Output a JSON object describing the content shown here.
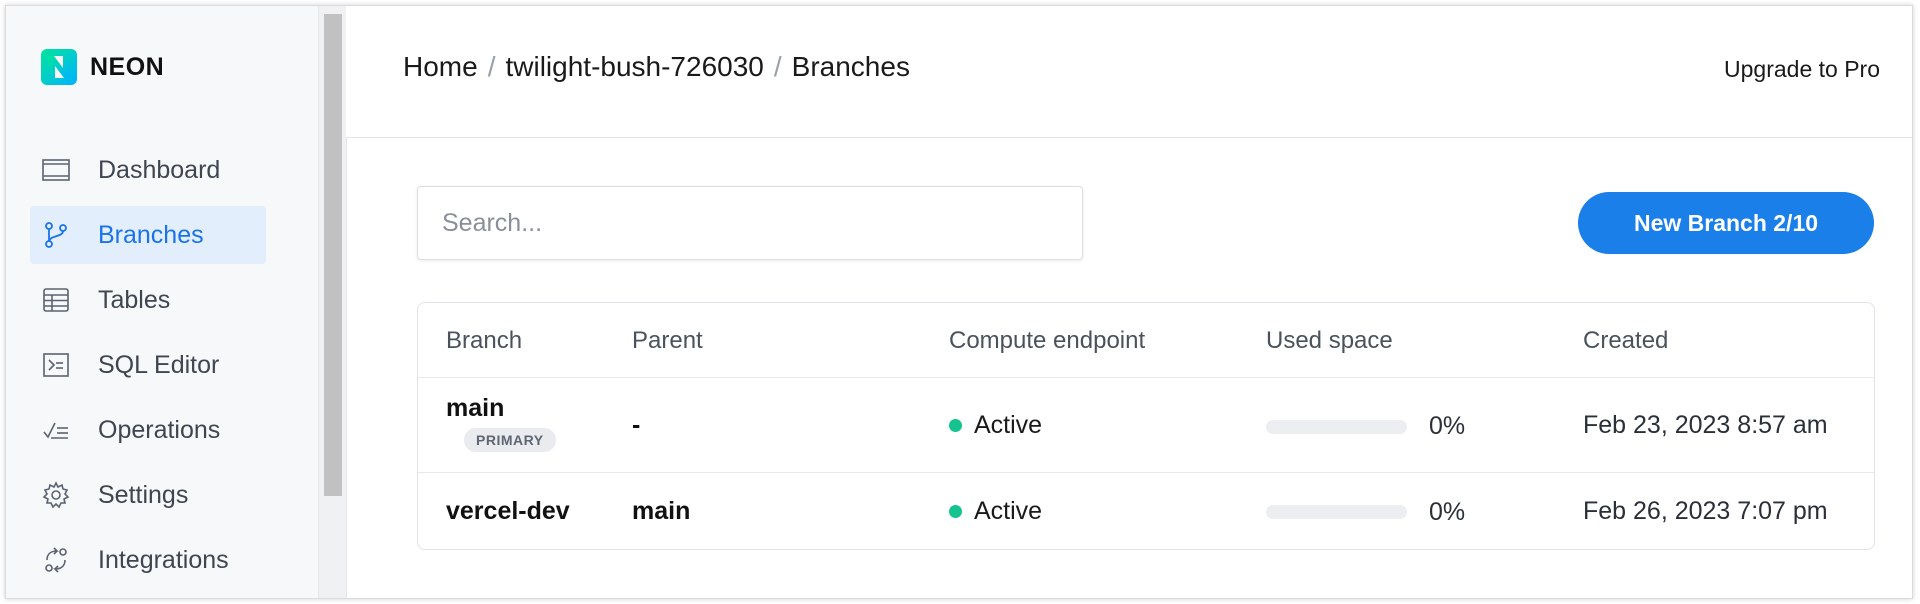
{
  "brand": {
    "name": "NEON",
    "accent": "#00e599"
  },
  "sidebar": {
    "items": [
      {
        "label": "Dashboard",
        "icon": "dashboard-icon"
      },
      {
        "label": "Branches",
        "icon": "branch-icon",
        "active": true
      },
      {
        "label": "Tables",
        "icon": "table-icon"
      },
      {
        "label": "SQL Editor",
        "icon": "terminal-icon"
      },
      {
        "label": "Operations",
        "icon": "operations-icon"
      },
      {
        "label": "Settings",
        "icon": "gear-icon"
      },
      {
        "label": "Integrations",
        "icon": "integrations-icon"
      }
    ]
  },
  "header": {
    "breadcrumb": [
      "Home",
      "twilight-bush-726030",
      "Branches"
    ],
    "separator": "/",
    "upgrade_label": "Upgrade to Pro"
  },
  "toolbar": {
    "search_placeholder": "Search...",
    "new_branch_label": "New Branch 2/10"
  },
  "table": {
    "columns": [
      "Branch",
      "Parent",
      "Compute endpoint",
      "Used space",
      "Created"
    ],
    "rows": [
      {
        "branch": "main",
        "badge": "PRIMARY",
        "parent": "-",
        "endpoint": "Active",
        "used_space": "0%",
        "used_fraction": 0,
        "created": "Feb 23, 2023 8:57 am"
      },
      {
        "branch": "vercel-dev",
        "parent": "main",
        "endpoint": "Active",
        "used_space": "0%",
        "used_fraction": 0,
        "created": "Feb 26, 2023 7:07 pm"
      }
    ]
  },
  "colors": {
    "primary": "#1a7fe8",
    "active_status": "#14c38e",
    "active_nav_bg": "#e3eefc"
  }
}
